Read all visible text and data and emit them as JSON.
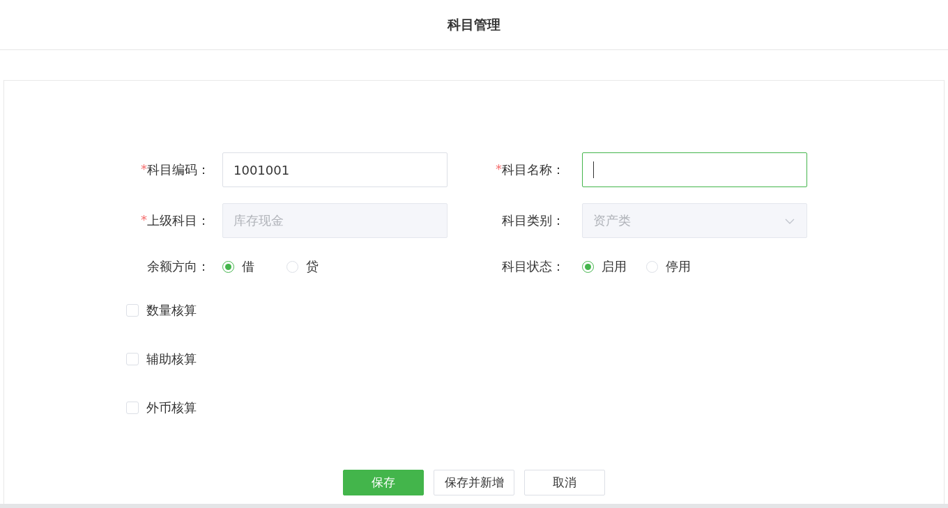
{
  "header": {
    "title": "科目管理"
  },
  "form_rows": [
    {
      "kind": "fields",
      "items": [
        {
          "kind": "input",
          "marker": "*",
          "label": "科目编码：",
          "value": "1001001",
          "disabled": false,
          "focused": false
        },
        {
          "kind": "input",
          "marker": "*",
          "label": "科目名称：",
          "value": "",
          "disabled": false,
          "focused": true
        }
      ]
    },
    {
      "kind": "fields",
      "items": [
        {
          "kind": "input",
          "marker": "*",
          "label": "上级科目：",
          "value": "库存现金",
          "disabled": true,
          "focused": false
        },
        {
          "kind": "select",
          "label": "科目类别：",
          "value": "资产类",
          "disabled": true
        }
      ]
    },
    {
      "kind": "fields",
      "items": [
        {
          "kind": "radio",
          "label": "余额方向：",
          "options": [
            {
              "label": "借",
              "selected": true
            },
            {
              "label": "贷",
              "selected": false
            }
          ]
        },
        {
          "kind": "radio",
          "label": "科目状态：",
          "options": [
            {
              "label": "启用",
              "selected": true
            },
            {
              "label": "停用",
              "selected": false
            }
          ]
        }
      ]
    }
  ],
  "checkboxes": [
    {
      "label": "数量核算",
      "checked": false
    },
    {
      "label": "辅助核算",
      "checked": false
    },
    {
      "label": "外币核算",
      "checked": false
    }
  ],
  "buttons": [
    {
      "label": "保存",
      "primary": true
    },
    {
      "label": "保存并新增",
      "primary": false
    },
    {
      "label": "取消",
      "primary": false
    }
  ]
}
